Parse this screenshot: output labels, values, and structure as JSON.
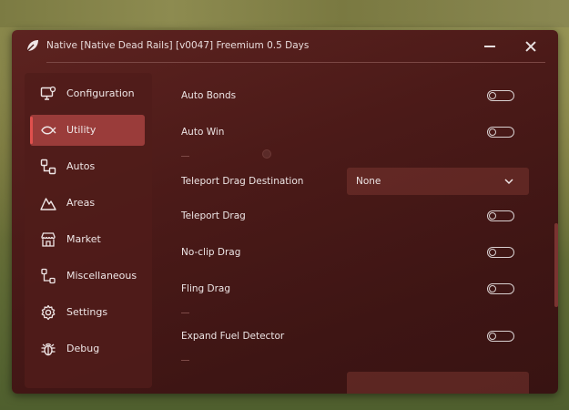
{
  "window": {
    "title": "Native [Native Dead Rails] [v0047] Freemium 0.5 Days"
  },
  "sidebar": {
    "items": [
      {
        "label": "Configuration",
        "icon": "monitor-settings-icon"
      },
      {
        "label": "Utility",
        "icon": "fish-icon",
        "active": true
      },
      {
        "label": "Autos",
        "icon": "workflow-icon"
      },
      {
        "label": "Areas",
        "icon": "mountain-icon"
      },
      {
        "label": "Market",
        "icon": "store-icon"
      },
      {
        "label": "Miscellaneous",
        "icon": "network-icon"
      },
      {
        "label": "Settings",
        "icon": "gear-icon"
      },
      {
        "label": "Debug",
        "icon": "bug-icon"
      }
    ]
  },
  "content": {
    "auto_bonds": {
      "label": "Auto Bonds",
      "enabled": false
    },
    "auto_win": {
      "label": "Auto Win",
      "enabled": false
    },
    "teleport_drag_destination": {
      "label": "Teleport Drag Destination",
      "value": "None"
    },
    "teleport_drag": {
      "label": "Teleport Drag",
      "enabled": false
    },
    "noclip_drag": {
      "label": "No-clip Drag",
      "enabled": false
    },
    "fling_drag": {
      "label": "Fling Drag",
      "enabled": false
    },
    "expand_fuel_detector": {
      "label": "Expand Fuel Detector",
      "enabled": false
    }
  },
  "colors": {
    "accent": "#e0504d",
    "active_item": "#9a3c3a",
    "window_bg": "#4b1a18"
  }
}
